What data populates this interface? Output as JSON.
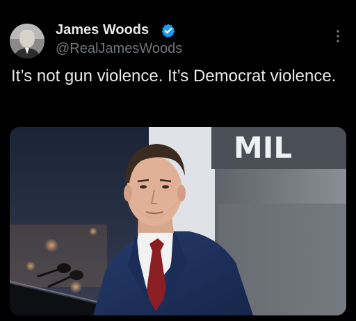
{
  "author": {
    "display_name": "James Woods",
    "handle": "@RealJamesWoods",
    "verified": true,
    "verified_color": "#1d9bf0"
  },
  "tweet": {
    "text": "It’s not gun violence. It’s Democrat violence."
  },
  "media": {
    "backdrop_text": "MIL",
    "accent_colors": {
      "suit": "#1f2f5c",
      "tie": "#8b1e22",
      "backdrop": "#dfe3e8"
    }
  },
  "icons": {
    "menu": "more-vertical-icon",
    "badge": "verified-badge-icon"
  }
}
